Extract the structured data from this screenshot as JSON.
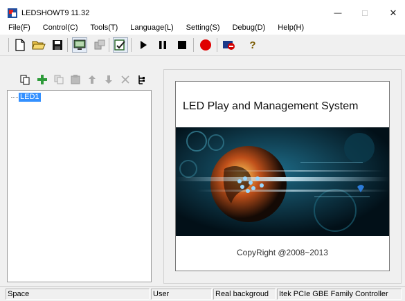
{
  "window": {
    "title": "LEDSHOWT9 11.32"
  },
  "window_controls": {
    "minimize": "—",
    "maximize": "☐",
    "close": "✕"
  },
  "menu": [
    "File(F)",
    "Control(C)",
    "Tools(T)",
    "Language(L)",
    "Setting(S)",
    "Debug(D)",
    "Help(H)"
  ],
  "toolbar_icons": [
    "new-file-icon",
    "open-folder-icon",
    "save-icon",
    "monitor-icon",
    "hardware-icon",
    "edit-icon",
    "play-icon",
    "pause-icon",
    "stop-icon",
    "record-icon",
    "screen-off-icon",
    "help-icon"
  ],
  "help_glyph": "?",
  "tree": {
    "root_label": "LED1"
  },
  "splash": {
    "title": "LED Play and Management System",
    "copyright": "CopyRight  @2008~2013"
  },
  "status": [
    "Space",
    "User",
    "Real backgroud",
    "Itek PCIe GBE Family Controller"
  ],
  "colors": {
    "tree_selection": "#3390ff",
    "add_green": "#2e9b3a",
    "record_red": "#e00000"
  }
}
